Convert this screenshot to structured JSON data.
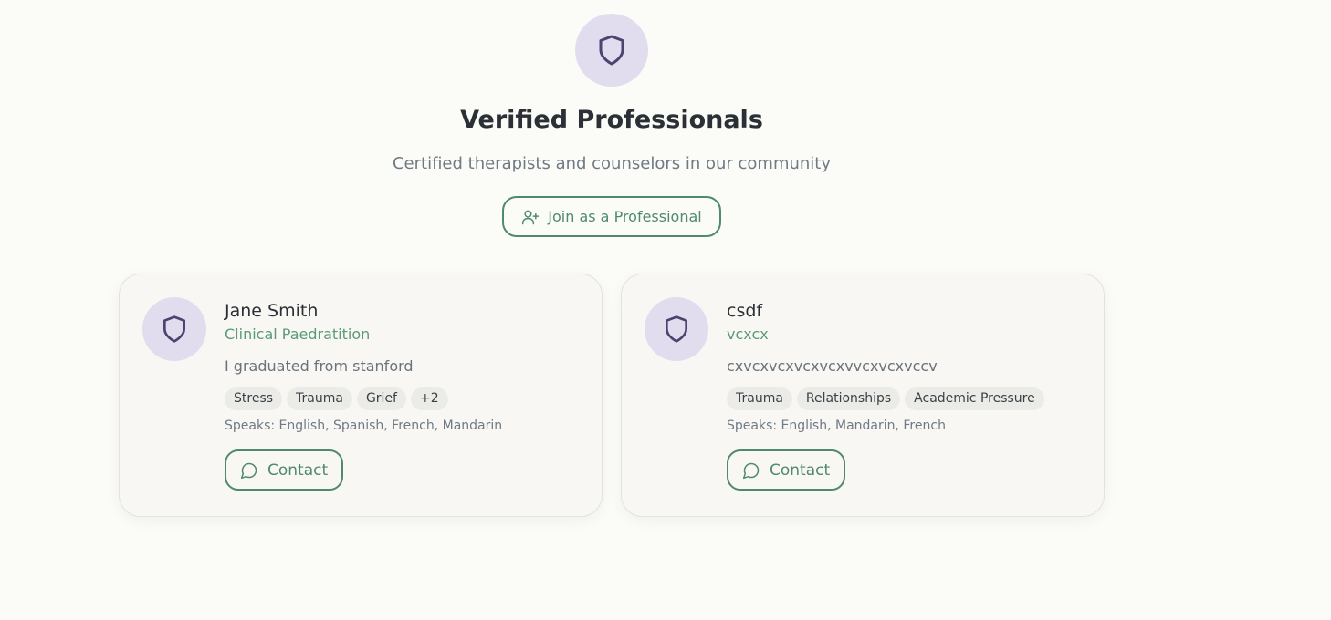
{
  "header": {
    "icon": "shield-icon",
    "title": "Verified Professionals",
    "subtitle": "Certified therapists and counselors in our community",
    "join_button": {
      "label": "Join as a Professional",
      "icon": "user-plus-icon"
    }
  },
  "professionals": [
    {
      "name": "Jane Smith",
      "title": "Clinical Paedratition",
      "bio": "I graduated from stanford",
      "tags": [
        "Stress",
        "Trauma",
        "Grief",
        "+2"
      ],
      "languages": "Speaks: English, Spanish, French, Mandarin",
      "contact_label": "Contact"
    },
    {
      "name": "csdf",
      "title": "vcxcx",
      "bio": "cxvcxvcxvcxvcxvvcxvcxvccv",
      "tags": [
        "Trauma",
        "Relationships",
        "Academic Pressure"
      ],
      "languages": "Speaks: English, Mandarin, French",
      "contact_label": "Contact"
    }
  ],
  "colors": {
    "accent": "#4f8a6c",
    "icon_circle": "#e2ddee",
    "icon_stroke": "#4b4470",
    "background": "#fbfbf8"
  }
}
